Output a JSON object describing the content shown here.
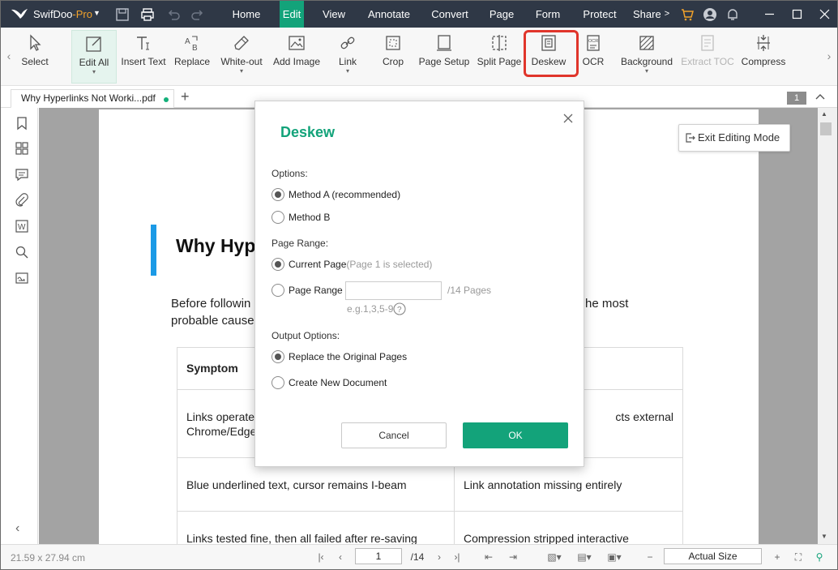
{
  "app": {
    "name": "SwifDoo",
    "name_suffix": "-Pro"
  },
  "menus": [
    "Home",
    "Edit",
    "View",
    "Annotate",
    "Convert",
    "Page",
    "Form",
    "Protect",
    "Share"
  ],
  "active_menu": "Edit",
  "ribbon": {
    "select": "Select",
    "edit_all": "Edit All",
    "insert_text": "Insert Text",
    "replace": "Replace",
    "white_out": "White-out",
    "add_image": "Add Image",
    "link": "Link",
    "crop": "Crop",
    "page_setup": "Page Setup",
    "split_page": "Split Page",
    "deskew": "Deskew",
    "ocr": "OCR",
    "background": "Background",
    "extract_toc": "Extract TOC",
    "compress": "Compress"
  },
  "tab": {
    "title": "Why Hyperlinks Not Worki...pdf",
    "page_badge": "1"
  },
  "exit_editing": "Exit Editing Mode",
  "document": {
    "heading": "Why Hyp",
    "para_line1_left": "Before followin",
    "para_line1_right": "he most",
    "para_line2_left": "probable cause",
    "table": {
      "header_left": "Symptom",
      "row1_left_l1": "Links operate",
      "row1_left_l2": "Chrome/Edge",
      "row1_right": "cts external",
      "row2_left": "Blue underlined text, cursor remains I-beam",
      "row2_right": "Link annotation missing entirely",
      "row3_left": "Links tested fine, then all failed after re-saving",
      "row3_right": "Compression stripped interactive"
    }
  },
  "dialog": {
    "title": "Deskew",
    "options_label": "Options:",
    "method_a": "Method A (recommended)",
    "method_b": "Method B",
    "page_range_label": "Page Range:",
    "current_page": "Current Page",
    "current_page_hint": "(Page 1 is selected)",
    "page_range": "Page Range",
    "range_value": "",
    "range_total": "/14 Pages",
    "range_example": "e.g.1,3,5-9",
    "output_label": "Output Options:",
    "replace_pages": "Replace the Original Pages",
    "create_new": "Create New Document",
    "cancel": "Cancel",
    "ok": "OK",
    "selected": {
      "method": "Method A",
      "range": "Current Page",
      "output": "Replace the Original Pages"
    }
  },
  "status": {
    "dimensions": "21.59 x 27.94 cm",
    "current_page": "1",
    "total_pages": "/14",
    "zoom": "Actual Size"
  },
  "colors": {
    "accent": "#13a37a",
    "titlebar": "#2f3846",
    "highlight": "#e0352b",
    "pro": "#f1a22b"
  }
}
